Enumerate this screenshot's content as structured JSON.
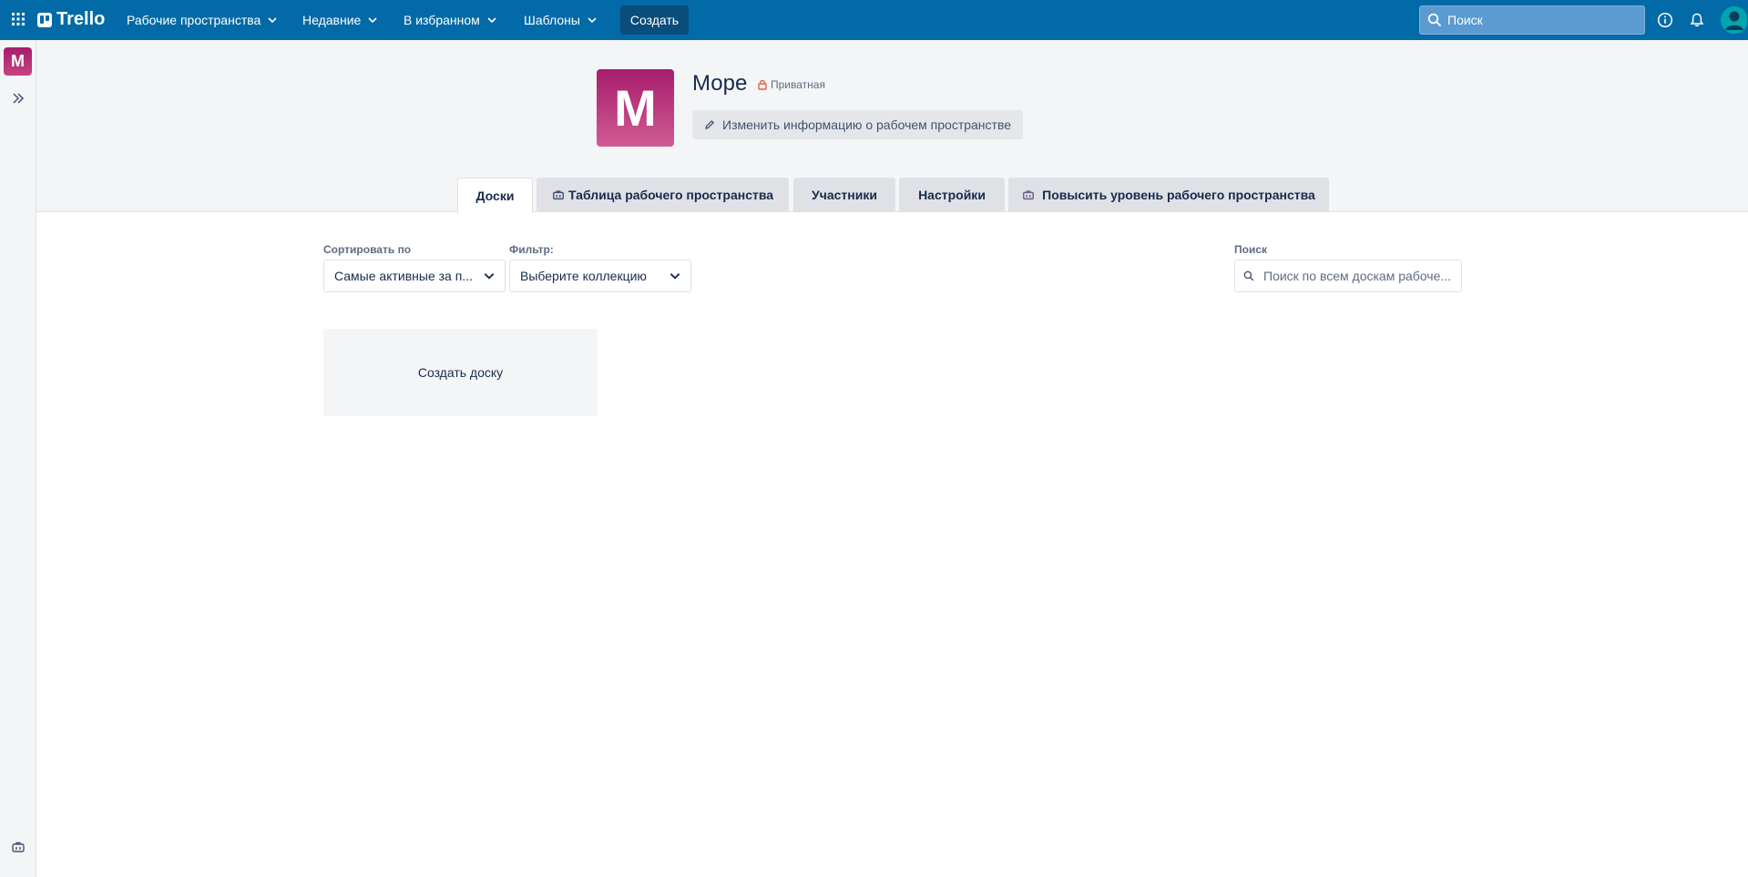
{
  "topbar": {
    "logo": "Trello",
    "nav": [
      {
        "label": "Рабочие пространства"
      },
      {
        "label": "Недавние"
      },
      {
        "label": "В избранном"
      },
      {
        "label": "Шаблоны"
      }
    ],
    "create_label": "Создать",
    "search_placeholder": "Поиск"
  },
  "sidebar": {
    "workspace_initial": "M"
  },
  "workspace": {
    "initial": "M",
    "name": "Море",
    "privacy": "Приватная",
    "edit_label": "Изменить информацию о рабочем пространстве"
  },
  "tabs": [
    {
      "label": "Доски"
    },
    {
      "label": "Таблица рабочего пространства"
    },
    {
      "label": "Участники"
    },
    {
      "label": "Настройки"
    },
    {
      "label": "Повысить уровень рабочего пространства"
    }
  ],
  "controls": {
    "sort_label": "Сортировать по",
    "sort_value": "Самые активные за п...",
    "filter_label": "Фильтр:",
    "filter_value": "Выберите коллекцию",
    "search_label": "Поиск",
    "search_placeholder": "Поиск по всем доскам рабоче..."
  },
  "boards": {
    "create_label": "Создать доску"
  },
  "colors": {
    "topbar": "#026aa7",
    "workspace_badge": "#b8317a",
    "lock": "#eb5a46"
  }
}
